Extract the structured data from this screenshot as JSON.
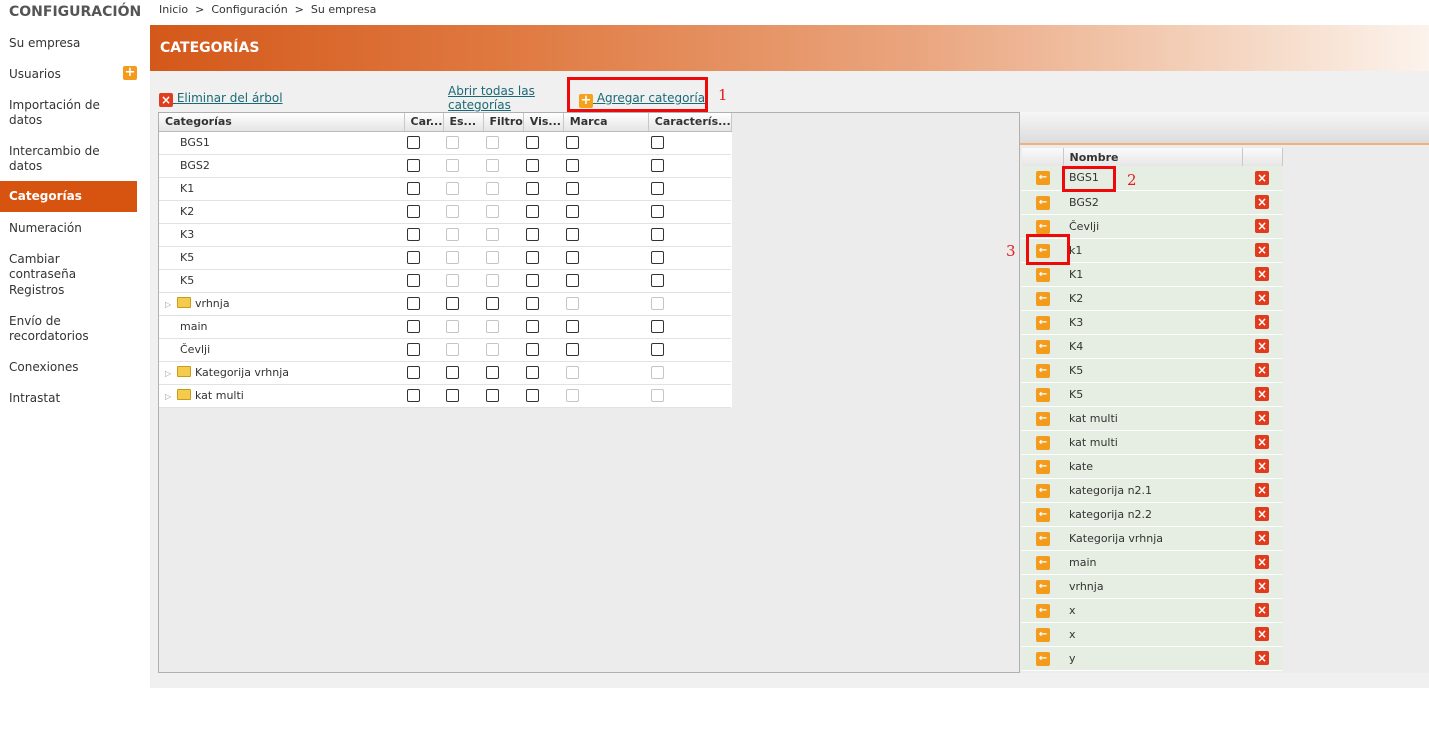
{
  "sidebar": {
    "title": "CONFIGURACIÓN",
    "items": [
      {
        "label": "Su empresa"
      },
      {
        "label": "Usuarios"
      },
      {
        "label": "Importación de datos"
      },
      {
        "label": "Intercambio de datos"
      },
      {
        "label": "Categorías"
      },
      {
        "label": "Numeración"
      },
      {
        "label": "Cambiar contraseña"
      },
      {
        "label": "Registros"
      },
      {
        "label": "Envío de recordatorios"
      },
      {
        "label": "Conexiones"
      },
      {
        "label": "Intrastat"
      }
    ]
  },
  "breadcrumb": [
    "Inicio",
    "Configuración",
    "Su empresa"
  ],
  "breadcrumb_sep": ">",
  "header": {
    "title": "CATEGORÍAS"
  },
  "toolbar": {
    "delete_tree": "Eliminar del árbol",
    "open_all": "Abrir todas las categorías",
    "add_category": "Agregar categoría"
  },
  "annotations": [
    "1",
    "2",
    "3"
  ],
  "tree": {
    "columns": [
      "Categorías",
      "Car...",
      "Es...",
      "Filtro",
      "Vis...",
      "Marca",
      "Caracterís..."
    ],
    "rows": [
      {
        "name": "BGS1"
      },
      {
        "name": "BGS2"
      },
      {
        "name": "K1"
      },
      {
        "name": "K2"
      },
      {
        "name": "K3"
      },
      {
        "name": "K5"
      },
      {
        "name": "K5"
      },
      {
        "name": "vrhnja"
      },
      {
        "name": "main"
      },
      {
        "name": "Čevlji"
      },
      {
        "name": "Kategorija vrhnja"
      },
      {
        "name": "kat multi"
      }
    ]
  },
  "names": {
    "header": "Nombre",
    "items": [
      "BGS1",
      "BGS2",
      "Čevlji",
      "k1",
      "K1",
      "K2",
      "K3",
      "K4",
      "K5",
      "K5",
      "kat multi",
      "kat multi",
      "kate",
      "kategorija n2.1",
      "kategorija n2.2",
      "Kategorija vrhnja",
      "main",
      "vrhnja",
      "x",
      "x",
      "y"
    ]
  },
  "icons": {
    "add": "plus-icon",
    "delete": "x-icon",
    "move": "arrow-left-icon",
    "folder": "folder-icon",
    "expand": "triangle-right-icon"
  },
  "colors": {
    "accent": "#d65410",
    "annotation": "#ee0a0a",
    "link": "#1a6a76"
  }
}
